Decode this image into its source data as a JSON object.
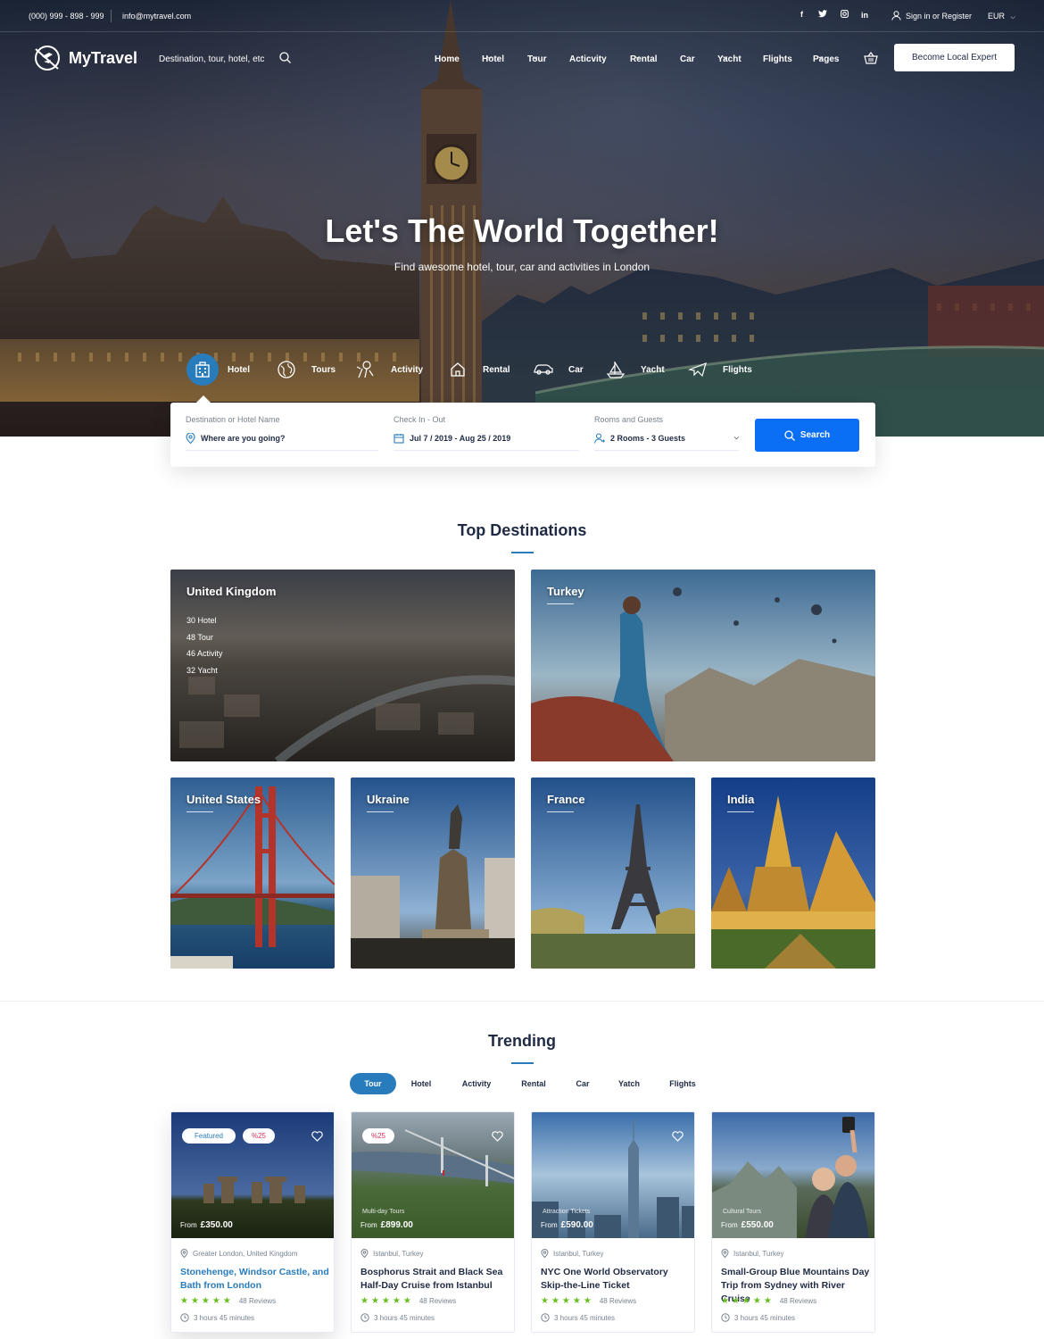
{
  "topbar": {
    "phone": "(000) 999 - 898 - 999",
    "email": "info@mytravel.com",
    "social": [
      "f",
      "t",
      "ig",
      "in"
    ],
    "signin": "Sign in or Register",
    "currency": "EUR"
  },
  "nav": {
    "brand": "MyTravel",
    "search_hint": "Destination, tour, hotel, etc",
    "menu": [
      {
        "label": "Home",
        "dropdown": false
      },
      {
        "label": "Hotel",
        "dropdown": true
      },
      {
        "label": "Tour",
        "dropdown": true
      },
      {
        "label": "Acticvity",
        "dropdown": false
      },
      {
        "label": "Rental",
        "dropdown": true
      },
      {
        "label": "Car",
        "dropdown": false
      },
      {
        "label": "Yacht",
        "dropdown": true
      },
      {
        "label": "Flights",
        "dropdown": false
      },
      {
        "label": "Pages",
        "dropdown": true
      }
    ],
    "cta": "Become Local Expert"
  },
  "hero": {
    "title": "Let's The World Together!",
    "subtitle": "Find awesome hotel, tour, car and activities in London"
  },
  "search_tabs": [
    {
      "label": "Hotel",
      "icon": "hotel-icon",
      "active": true
    },
    {
      "label": "Tours",
      "icon": "globe-icon",
      "active": false
    },
    {
      "label": "Activity",
      "icon": "activity-icon",
      "active": false
    },
    {
      "label": "Rental",
      "icon": "house-icon",
      "active": false
    },
    {
      "label": "Car",
      "icon": "car-icon",
      "active": false
    },
    {
      "label": "Yacht",
      "icon": "yacht-icon",
      "active": false
    },
    {
      "label": "Flights",
      "icon": "plane-icon",
      "active": false
    }
  ],
  "search": {
    "destination_label": "Destination or Hotel Name",
    "destination_value": "Where are you going?",
    "dates_label": "Check In - Out",
    "dates_value": "Jul 7 / 2019 - Aug 25 / 2019",
    "guests_label": "Rooms and Guests",
    "guests_value": "2 Rooms - 3 Guests",
    "button": "Search"
  },
  "top_destinations": {
    "title": "Top Destinations",
    "items": [
      {
        "name": "United Kingdom",
        "stats": [
          "30 Hotel",
          "48 Tour",
          "46 Activity",
          "32 Yacht"
        ]
      },
      {
        "name": "Turkey"
      },
      {
        "name": "United States"
      },
      {
        "name": "Ukraine"
      },
      {
        "name": "France"
      },
      {
        "name": "India"
      }
    ]
  },
  "trending": {
    "title": "Trending",
    "tabs": [
      "Tour",
      "Hotel",
      "Activity",
      "Rental",
      "Car",
      "Yatch",
      "Flights"
    ],
    "active_tab": "Tour",
    "cards": [
      {
        "featured": "Featured",
        "discount": "%25",
        "category": "",
        "price_prefix": "From",
        "price": "£350.00",
        "location": "Greater London, United Kingdom",
        "title": "Stonehenge, Windsor Castle, and Bath from London",
        "stars": 5,
        "reviews": "48 Reviews",
        "duration": "3 hours 45 minutes"
      },
      {
        "featured": "",
        "discount": "%25",
        "category": "Multi-day Tours",
        "price_prefix": "From",
        "price": "£899.00",
        "location": "Istanbul, Turkey",
        "title": "Bosphorus Strait and Black Sea Half-Day Cruise from Istanbul",
        "stars": 5,
        "reviews": "48 Reviews",
        "duration": "3 hours 45 minutes"
      },
      {
        "featured": "",
        "discount": "",
        "category": "Attraction Tickets",
        "price_prefix": "From",
        "price": "£590.00",
        "location": "Istanbul, Turkey",
        "title": "NYC One World Observatory Skip-the-Line Ticket",
        "stars": 5,
        "reviews": "48 Reviews",
        "duration": "3 hours 45 minutes"
      },
      {
        "featured": "",
        "discount": "",
        "category": "Cultural Tours",
        "price_prefix": "From",
        "price": "£550.00",
        "location": "Istanbul, Turkey",
        "title": "Small-Group Blue Mountains Day Trip from Sydney with River Cruise",
        "stars": 5,
        "reviews": "48 Reviews",
        "duration": "3 hours 45 minutes"
      }
    ]
  },
  "colors": {
    "accent": "#297cbb",
    "button": "#0b6ff5",
    "star": "#68be1c",
    "discount": "#de2e5a"
  }
}
